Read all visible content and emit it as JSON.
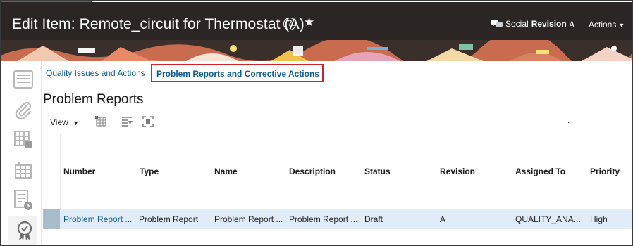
{
  "header": {
    "title": "Edit Item: Remote_circuit for Thermostat (A)",
    "help_icon": "?",
    "favorite_icon": "★",
    "social_label": "Social",
    "revision_label": "Revision",
    "revision_value": "A",
    "actions_label": "Actions"
  },
  "tabs": [
    {
      "label": "Quality Issues and Actions",
      "selected": false
    },
    {
      "label": "Problem Reports and Corrective Actions",
      "selected": true
    }
  ],
  "section": {
    "title": "Problem Reports"
  },
  "toolbar": {
    "view_label": "View",
    "dot": "."
  },
  "table": {
    "columns": [
      "Number",
      "Type",
      "Name",
      "Description",
      "Status",
      "Revision",
      "Assigned To",
      "Priority"
    ],
    "rows": [
      [
        "Problem Report ...",
        "Problem Report",
        "Problem Report ...",
        "Problem Report ...",
        "Draft",
        "A",
        "QUALITY_ANA...",
        "High"
      ]
    ]
  },
  "rail": {
    "icons": [
      "list-icon",
      "attachment-icon",
      "grid-settings-icon",
      "building-icon",
      "report-clock-icon",
      "quality-badge-icon"
    ]
  },
  "colors": {
    "header_bg": "#2b2623",
    "link": "#0e5c8f",
    "highlight_box": "#d1232a",
    "row_selected": "#e0edf8"
  }
}
